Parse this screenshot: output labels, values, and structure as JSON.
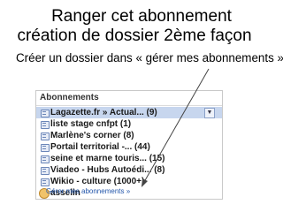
{
  "slide": {
    "title_line1": "Ranger cet abonnement",
    "title_line2": "création de dossier 2ème façon",
    "subtitle": "Créer un dossier dans « gérer mes abonnements »"
  },
  "panel": {
    "title": "Abonnements",
    "items": [
      {
        "label": "Lagazette.fr » Actual... (9)",
        "icon": "feed-icon",
        "selected": true
      },
      {
        "label": "liste stage cnfpt (1)",
        "icon": "feed-icon",
        "selected": false
      },
      {
        "label": "Marlène's corner (8)",
        "icon": "feed-icon",
        "selected": false
      },
      {
        "label": "Portail territorial -... (44)",
        "icon": "feed-icon",
        "selected": false
      },
      {
        "label": "seine et marne touris... (15)",
        "icon": "feed-icon",
        "selected": false
      },
      {
        "label": "Viadeo - Hubs Autoédi... (8)",
        "icon": "feed-icon",
        "selected": false
      },
      {
        "label": "Wikio - culture (1000+)",
        "icon": "feed-icon",
        "selected": false
      },
      {
        "label": "asselin",
        "icon": "user-icon",
        "selected": false
      }
    ],
    "manage_link": "Gérer mes abonnements »",
    "dropdown_glyph": "▼"
  },
  "colors": {
    "selected_row": "#c7d6ee",
    "link": "#2255aa",
    "arrow": "#444444"
  }
}
